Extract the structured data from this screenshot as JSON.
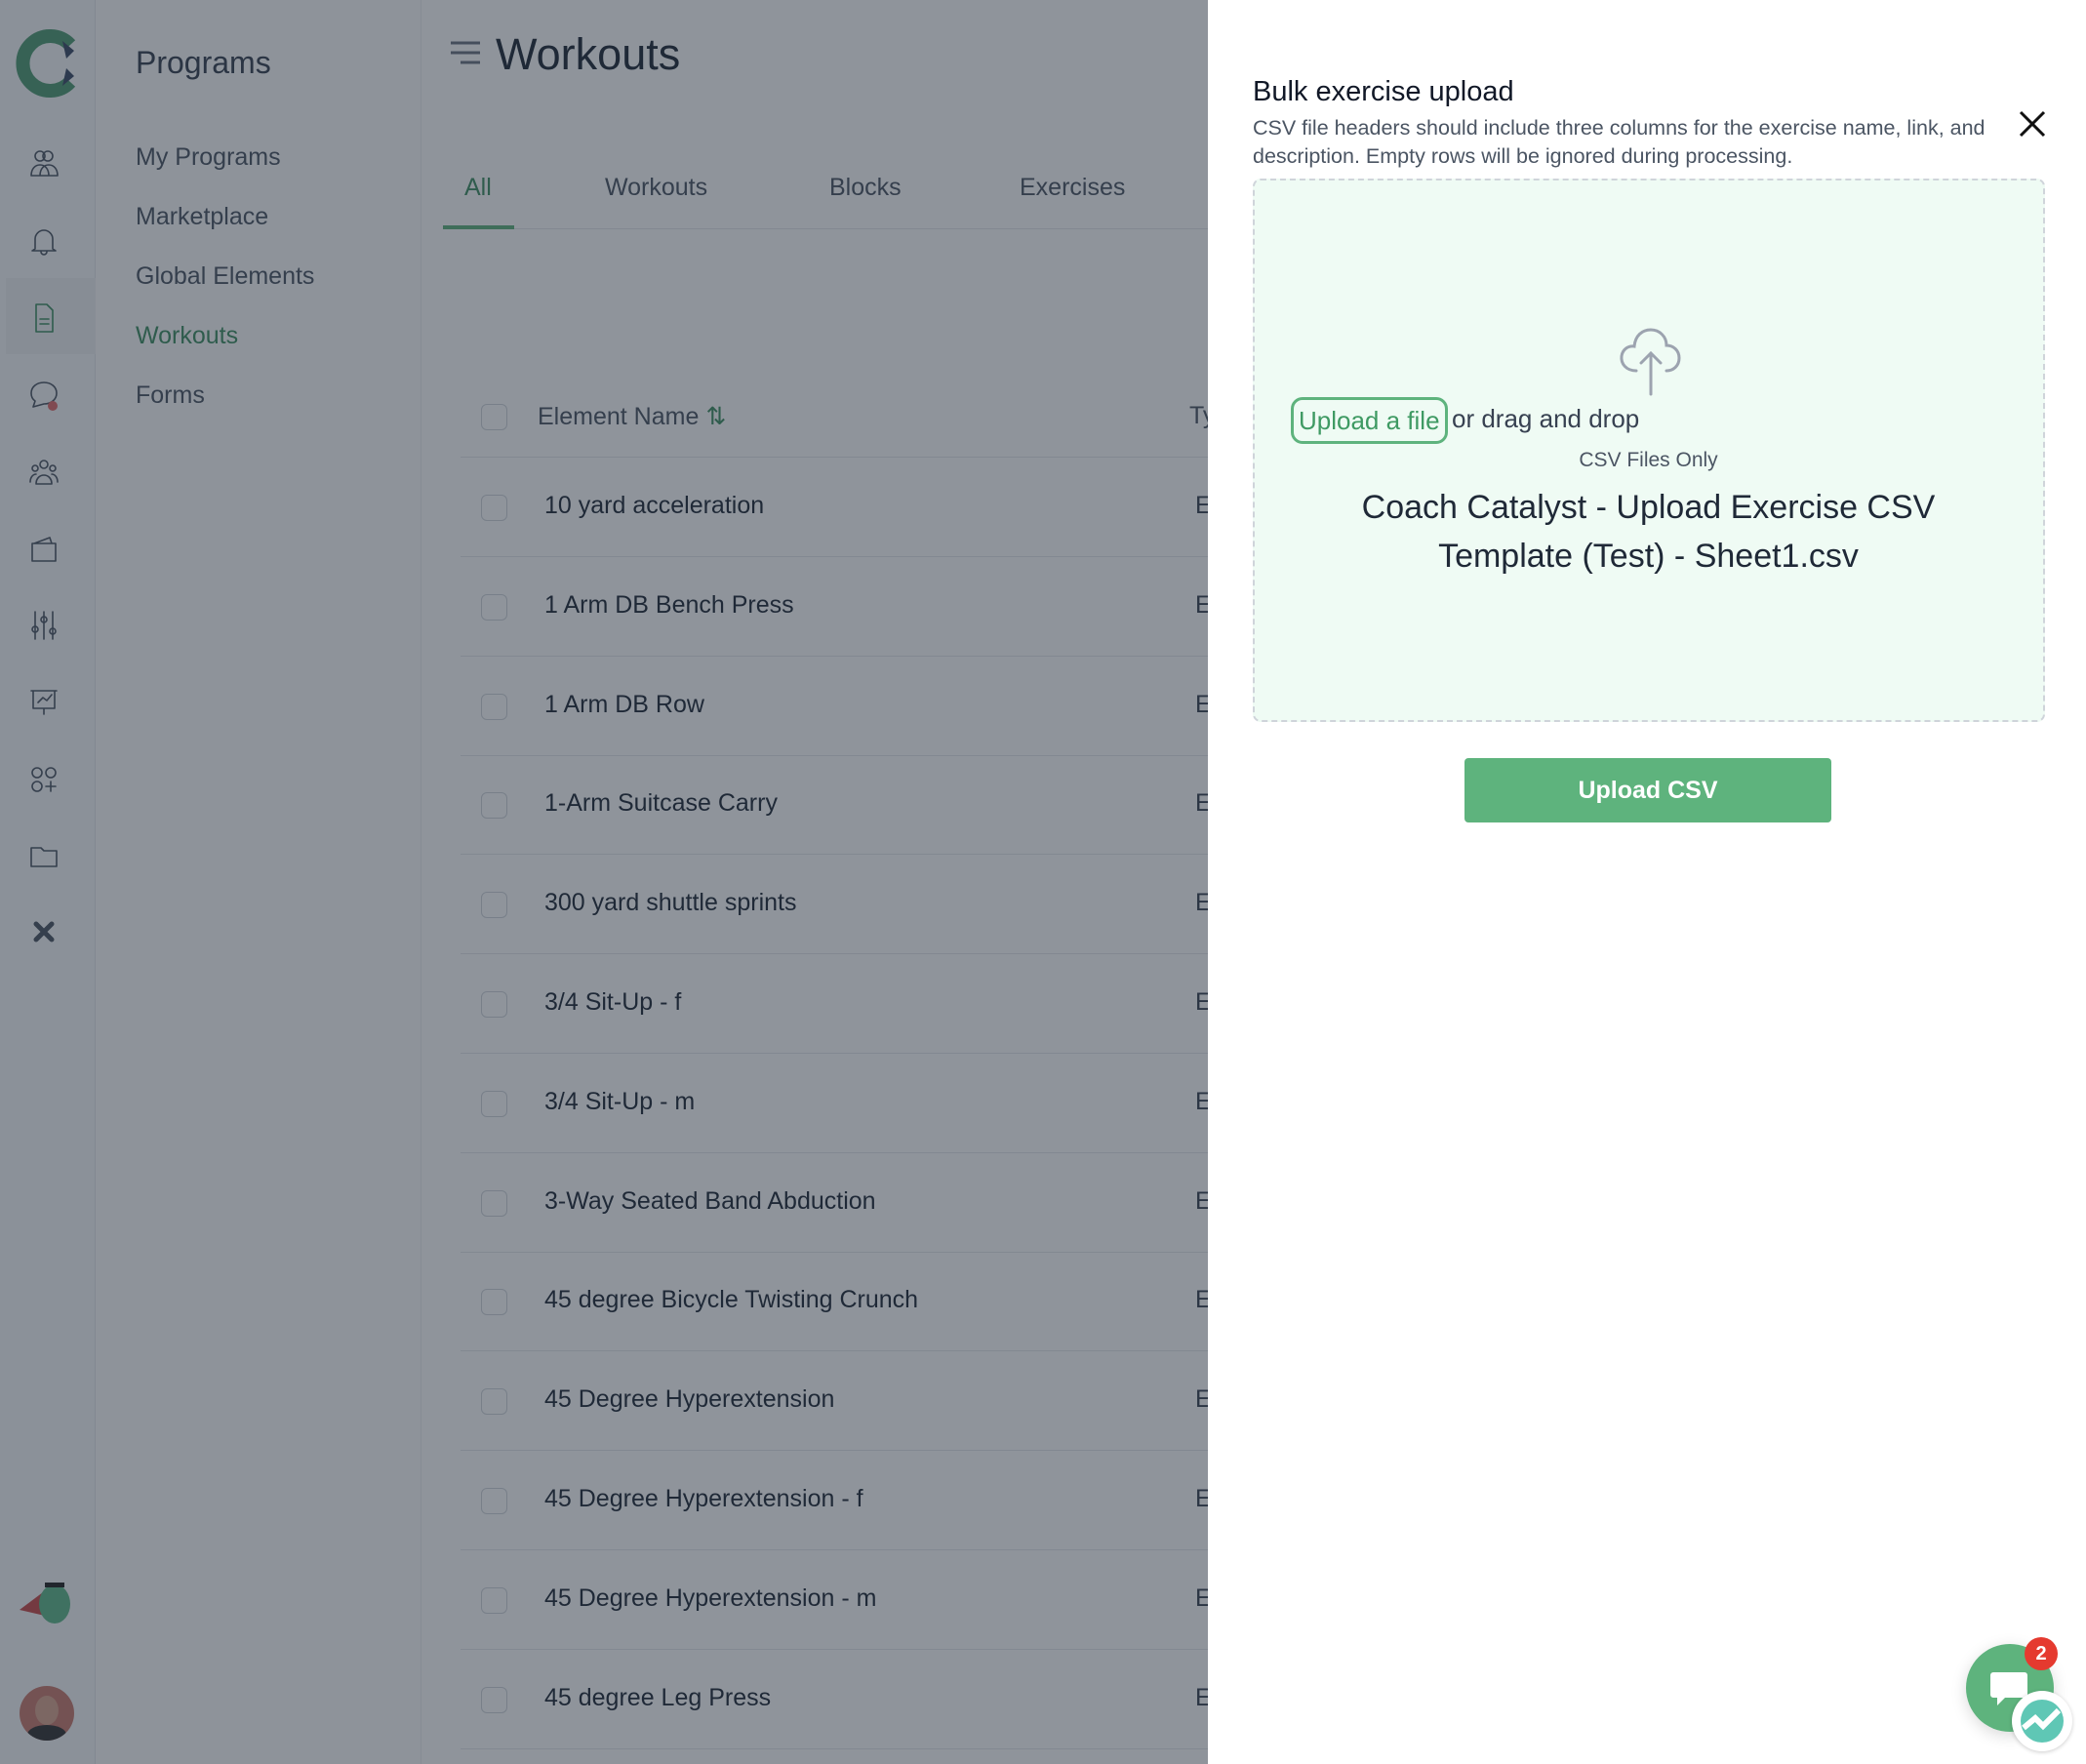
{
  "sidebar": {
    "title": "Programs",
    "items": [
      {
        "label": "My Programs"
      },
      {
        "label": "Marketplace"
      },
      {
        "label": "Global Elements"
      },
      {
        "label": "Workouts",
        "active": true
      },
      {
        "label": "Forms"
      }
    ]
  },
  "rail_icons": [
    "users-icon",
    "bell-icon",
    "document-icon",
    "chat-icon",
    "team-icon",
    "wallet-icon",
    "sliders-icon",
    "presentation-icon",
    "apps-icon",
    "folder-icon",
    "close-x-icon"
  ],
  "main": {
    "title": "Workouts",
    "tabs": [
      {
        "label": "All",
        "active": true
      },
      {
        "label": "Workouts"
      },
      {
        "label": "Blocks"
      },
      {
        "label": "Exercises"
      }
    ],
    "table": {
      "col_name": "Element Name",
      "col_type": "Type",
      "rows": [
        {
          "name": "10 yard acceleration",
          "type": "Exercise"
        },
        {
          "name": "1 Arm DB Bench Press",
          "type": "Exercise"
        },
        {
          "name": "1 Arm DB Row",
          "type": "Exercise"
        },
        {
          "name": "1-Arm Suitcase Carry",
          "type": "Exercise"
        },
        {
          "name": "300 yard shuttle sprints",
          "type": "Exercise"
        },
        {
          "name": "3/4 Sit-Up - f",
          "type": "Exercise"
        },
        {
          "name": "3/4 Sit-Up - m",
          "type": "Exercise"
        },
        {
          "name": "3-Way Seated Band Abduction",
          "type": "Exercise"
        },
        {
          "name": "45 degree Bicycle Twisting Crunch",
          "type": "Exercise"
        },
        {
          "name": "45 Degree Hyperextension",
          "type": "Exercise"
        },
        {
          "name": "45 Degree Hyperextension - f",
          "type": "Exercise"
        },
        {
          "name": "45 Degree Hyperextension - m",
          "type": "Exercise"
        },
        {
          "name": "45 degree Leg Press",
          "type": "Exercise"
        }
      ]
    }
  },
  "panel": {
    "title": "Bulk exercise upload",
    "description": "CSV file headers should include three columns for the exercise name, link, and description. Empty rows will be ignored during processing.",
    "upload_link": "Upload a file",
    "drag_text": "or drag and drop",
    "file_hint": "CSV Files Only",
    "selected_file": "Coach Catalyst - Upload Exercise CSV Template (Test) - Sheet1.csv",
    "submit_label": "Upload CSV"
  },
  "chat": {
    "badge": "2"
  },
  "colors": {
    "accent": "#5eb37d",
    "active_text": "#3f8f62",
    "badge": "#e53a2f"
  }
}
